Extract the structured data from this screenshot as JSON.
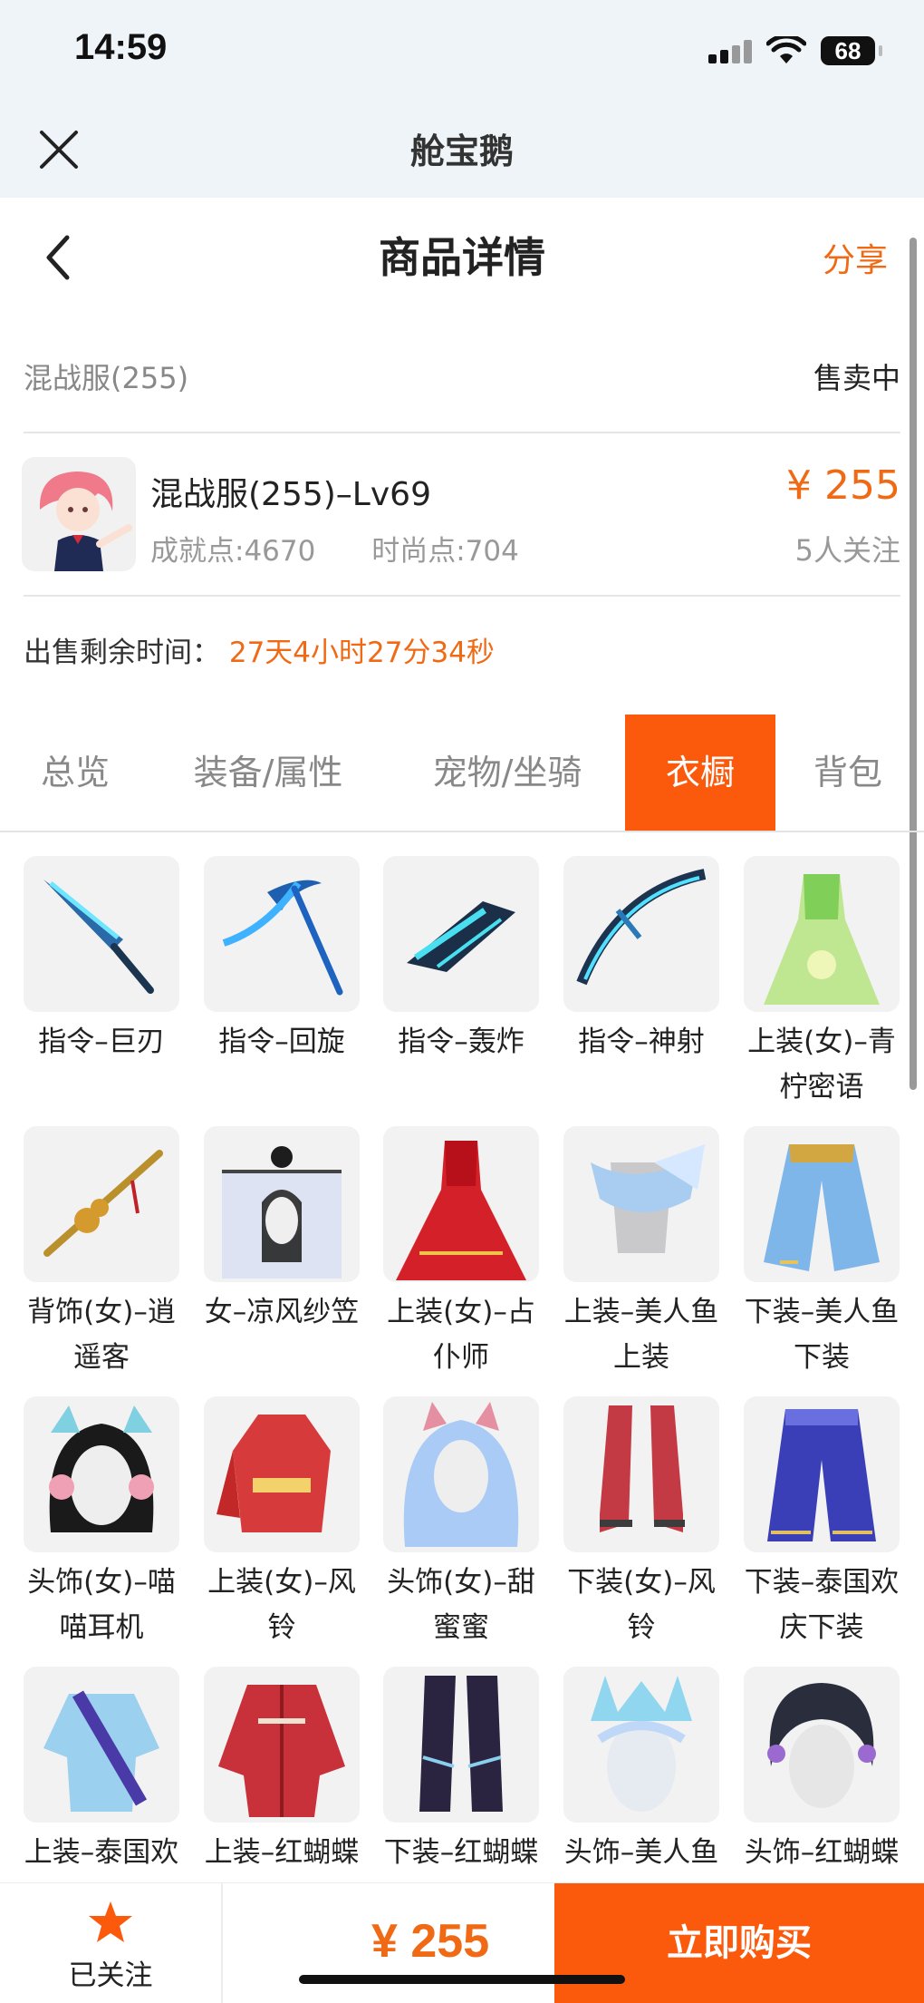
{
  "status": {
    "time": "14:59",
    "battery": "68"
  },
  "app": {
    "title": "舱宝鹅"
  },
  "nav": {
    "title": "商品详情",
    "share_label": "分享"
  },
  "listing": {
    "server": "混战服(255)",
    "sale_status": "售卖中",
    "account_title": "混战服(255)–Lv69",
    "achievement": "成就点:4670",
    "fashion": "时尚点:704",
    "price": "¥ 255",
    "followers": "5人关注",
    "remaining_label": "出售剩余时间：",
    "remaining_value": "27天4小时27分34秒"
  },
  "tabs": [
    {
      "label": "总览",
      "active": false
    },
    {
      "label": "装备/属性",
      "active": false
    },
    {
      "label": "宠物/坐骑",
      "active": false
    },
    {
      "label": "衣橱",
      "active": true
    },
    {
      "label": "背包",
      "active": false
    }
  ],
  "wardrobe": [
    {
      "label": "指令–巨刃",
      "icon": "blade-icon"
    },
    {
      "label": "指令–回旋",
      "icon": "scythe-icon"
    },
    {
      "label": "指令–轰炸",
      "icon": "blaster-icon"
    },
    {
      "label": "指令–神射",
      "icon": "bow-icon"
    },
    {
      "label": "上装(女)–青柠密语",
      "icon": "green-dress-icon"
    },
    {
      "label": "背饰(女)–逍遥客",
      "icon": "gourd-staff-icon"
    },
    {
      "label": "女–凉风纱笠",
      "icon": "veil-hat-icon"
    },
    {
      "label": "上装(女)–占仆师",
      "icon": "red-dress-icon"
    },
    {
      "label": "上装–美人鱼上装",
      "icon": "mermaid-top-icon"
    },
    {
      "label": "下装–美人鱼下装",
      "icon": "mermaid-bottom-icon"
    },
    {
      "label": "头饰(女)–喵喵耳机",
      "icon": "cat-headphones-icon"
    },
    {
      "label": "上装(女)–风铃",
      "icon": "red-kimono-icon"
    },
    {
      "label": "头饰(女)–甜蜜蜜",
      "icon": "blue-hair-icon"
    },
    {
      "label": "下装(女)–风铃",
      "icon": "red-boots-icon"
    },
    {
      "label": "下装–泰国欢庆下装",
      "icon": "purple-pants-icon"
    },
    {
      "label": "上装–泰国欢庆上装",
      "icon": "thai-top-icon"
    },
    {
      "label": "上装–红蝴蝶衣",
      "icon": "red-jacket-icon"
    },
    {
      "label": "下装–红蝴蝶裤",
      "icon": "dark-pants-icon"
    },
    {
      "label": "头饰–美人鱼之冠",
      "icon": "mermaid-crown-icon"
    },
    {
      "label": "头饰–红蝴蝶头冠",
      "icon": "dark-hair-icon"
    }
  ],
  "bottom": {
    "follow_label": "已关注",
    "price": "¥ 255",
    "buy_label": "立即购买"
  },
  "colors": {
    "accent": "#fb5a0c",
    "price": "#f06a15"
  }
}
